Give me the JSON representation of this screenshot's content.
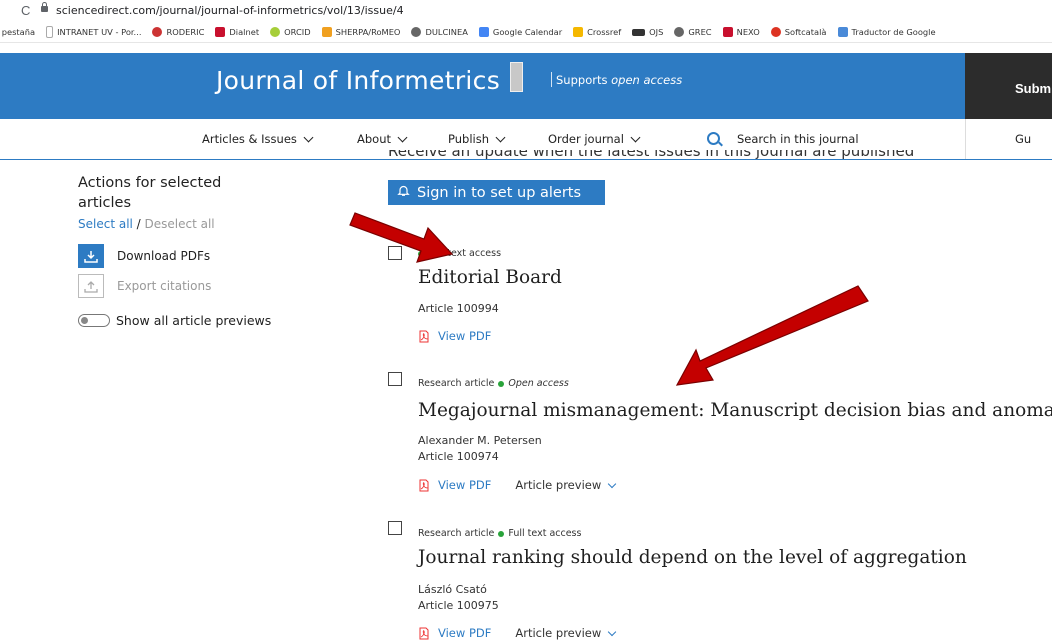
{
  "browser": {
    "url": "sciencedirect.com/journal/journal-of-informetrics/vol/13/issue/4",
    "bookmarks": [
      "a pestaña",
      "INTRANET UV - Por...",
      "RODERIC",
      "Dialnet",
      "ORCID",
      "SHERPA/RoMEO",
      "DULCINEA",
      "Google Calendar",
      "Crossref",
      "OJS",
      "GREC",
      "NEXO",
      "Softcatalà",
      "Traductor de Google"
    ]
  },
  "header": {
    "journal_title": "Journal of Informetrics",
    "supports_prefix": "Supports ",
    "supports_emph": "open access",
    "submit_label": "Subm"
  },
  "nav": {
    "items": [
      "Articles & Issues",
      "About",
      "Publish",
      "Order journal"
    ],
    "search_placeholder": "Search in this journal",
    "right_partial": "Gu"
  },
  "alerts": {
    "clipped_text": "Receive an update when the latest issues in this journal are published",
    "button_label": "Sign in to set up alerts"
  },
  "sidebar": {
    "heading": "Actions for selected articles",
    "select_all": "Select all",
    "separator": " / ",
    "deselect_all": "Deselect all",
    "download": "Download PDFs",
    "export": "Export citations",
    "toggle": "Show all article previews"
  },
  "articles": [
    {
      "type": "",
      "access": "Full text access",
      "title": "Editorial Board",
      "author": "",
      "number": "Article 100994",
      "pdf": "View PDF",
      "preview": ""
    },
    {
      "type": "Research article",
      "access": "Open access",
      "title": "Megajournal mismanagement: Manuscript decision bias and anomalou",
      "author": "Alexander M. Petersen",
      "number": "Article 100974",
      "pdf": "View PDF",
      "preview": "Article preview"
    },
    {
      "type": "Research article",
      "access": "Full text access",
      "title": "Journal ranking should depend on the level of aggregation",
      "author": "László Csató",
      "number": "Article 100975",
      "pdf": "View PDF",
      "preview": "Article preview"
    }
  ],
  "colors": {
    "brand_blue": "#2d7bc3",
    "open_access_green": "#29a33a",
    "annotation_red": "#c40000"
  }
}
